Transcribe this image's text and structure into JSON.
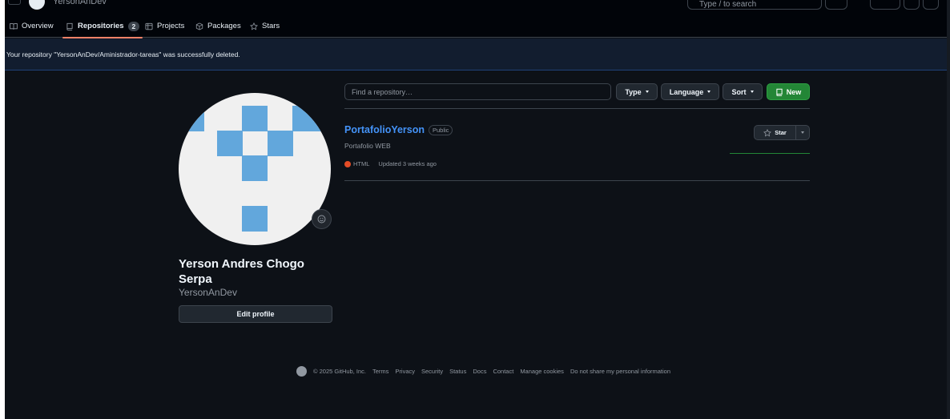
{
  "header": {
    "owner": "YersonAnDev",
    "search_placeholder": "Type / to search"
  },
  "nav": {
    "tabs": [
      {
        "label": "Overview",
        "icon": "book-icon"
      },
      {
        "label": "Repositories",
        "icon": "repo-icon",
        "count": "2",
        "active": true
      },
      {
        "label": "Projects",
        "icon": "table-icon"
      },
      {
        "label": "Packages",
        "icon": "package-icon"
      },
      {
        "label": "Stars",
        "icon": "star-icon"
      }
    ]
  },
  "flash": {
    "message": "Your repository \"YersonAnDev/Aministrador-tareas\" was successfully deleted."
  },
  "profile": {
    "full_name": "Yerson Andres Chogo Serpa",
    "username": "YersonAnDev",
    "edit_label": "Edit profile"
  },
  "filters": {
    "find_placeholder": "Find a repository…",
    "type_label": "Type",
    "language_label": "Language",
    "sort_label": "Sort",
    "new_label": "New"
  },
  "repos": [
    {
      "name": "PortafolioYerson",
      "visibility": "Public",
      "description": "Portafolio WEB",
      "language": "HTML",
      "language_color": "#e34c26",
      "updated": "Updated 3 weeks ago",
      "star_label": "Star"
    }
  ],
  "footer": {
    "copyright": "© 2025 GitHub, Inc.",
    "links": [
      "Terms",
      "Privacy",
      "Security",
      "Status",
      "Docs",
      "Contact",
      "Manage cookies",
      "Do not share my personal information"
    ]
  },
  "colors": {
    "background": "#0d1117",
    "link": "#4493f8",
    "accent_green": "#238636",
    "tab_underline": "#f78166",
    "avatar_blue": "#62a7dc"
  }
}
